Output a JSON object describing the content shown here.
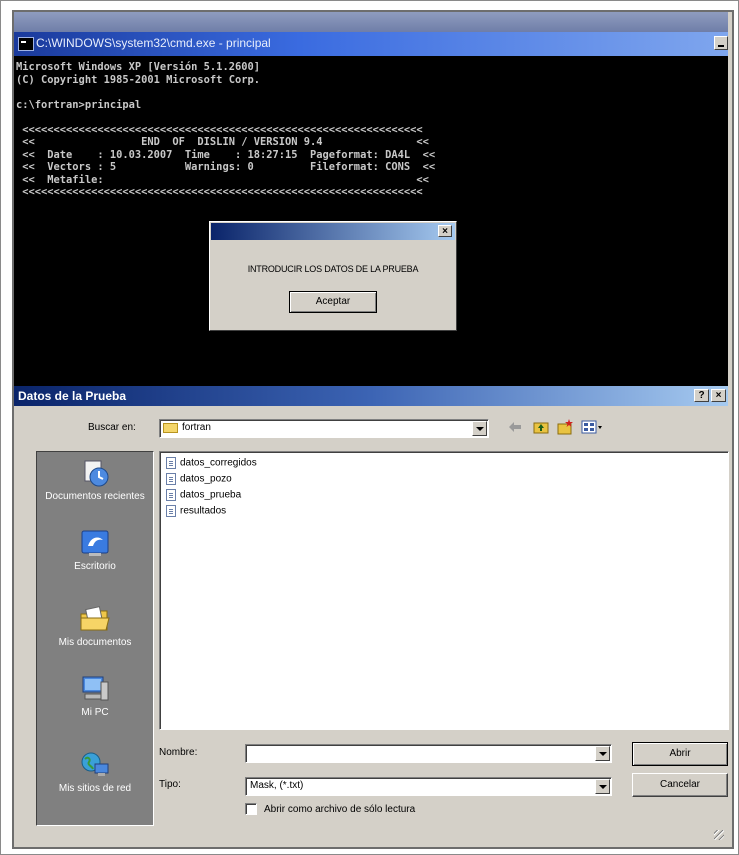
{
  "cmd": {
    "title": "C:\\WINDOWS\\system32\\cmd.exe - principal",
    "lines": [
      "Microsoft Windows XP [Versión 5.1.2600]",
      "(C) Copyright 1985-2001 Microsoft Corp.",
      "",
      "c:\\fortran>principal",
      "",
      " <<<<<<<<<<<<<<<<<<<<<<<<<<<<<<<<<<<<<<<<<<<<<<<<<<<<<<<<<<<<<<<<",
      " <<                 END  OF  DISLIN / VERSION 9.4               <<",
      " <<  Date    : 10.03.2007  Time    : 18:27:15  Pageformat: DA4L  <<",
      " <<  Vectors : 5           Warnings: 0         Fileformat: CONS  <<",
      " <<  Metafile:                                                  <<",
      " <<<<<<<<<<<<<<<<<<<<<<<<<<<<<<<<<<<<<<<<<<<<<<<<<<<<<<<<<<<<<<<<"
    ]
  },
  "message_box": {
    "close_glyph": "×",
    "text": "INTRODUCIR LOS DATOS DE LA PRUEBA",
    "button": "Aceptar"
  },
  "dialog": {
    "title": "Datos de la Prueba",
    "help_glyph": "?",
    "close_glyph": "×",
    "look_in_label": "Buscar en:",
    "look_in_value": "fortran",
    "places": [
      {
        "label": "Documentos recientes",
        "icon": "recent-documents-icon"
      },
      {
        "label": "Escritorio",
        "icon": "desktop-icon"
      },
      {
        "label": "Mis documentos",
        "icon": "my-documents-icon"
      },
      {
        "label": "Mi PC",
        "icon": "my-computer-icon"
      },
      {
        "label": "Mis sitios de red",
        "icon": "network-places-icon"
      }
    ],
    "files": [
      "datos_corregidos",
      "datos_pozo",
      "datos_prueba",
      "resultados"
    ],
    "filename_label": "Nombre:",
    "filename_value": "",
    "type_label": "Tipo:",
    "type_value": "Mask, (*.txt)",
    "readonly_label": "Abrir como archivo de sólo lectura",
    "readonly_checked": false,
    "open_button": "Abrir",
    "cancel_button": "Cancelar"
  },
  "colors": {
    "console_bg": "#000000",
    "console_text": "#c8c8c8",
    "title_active": "#0a246a",
    "dialog_face": "#d4d0c8",
    "places_bar": "#808080"
  }
}
